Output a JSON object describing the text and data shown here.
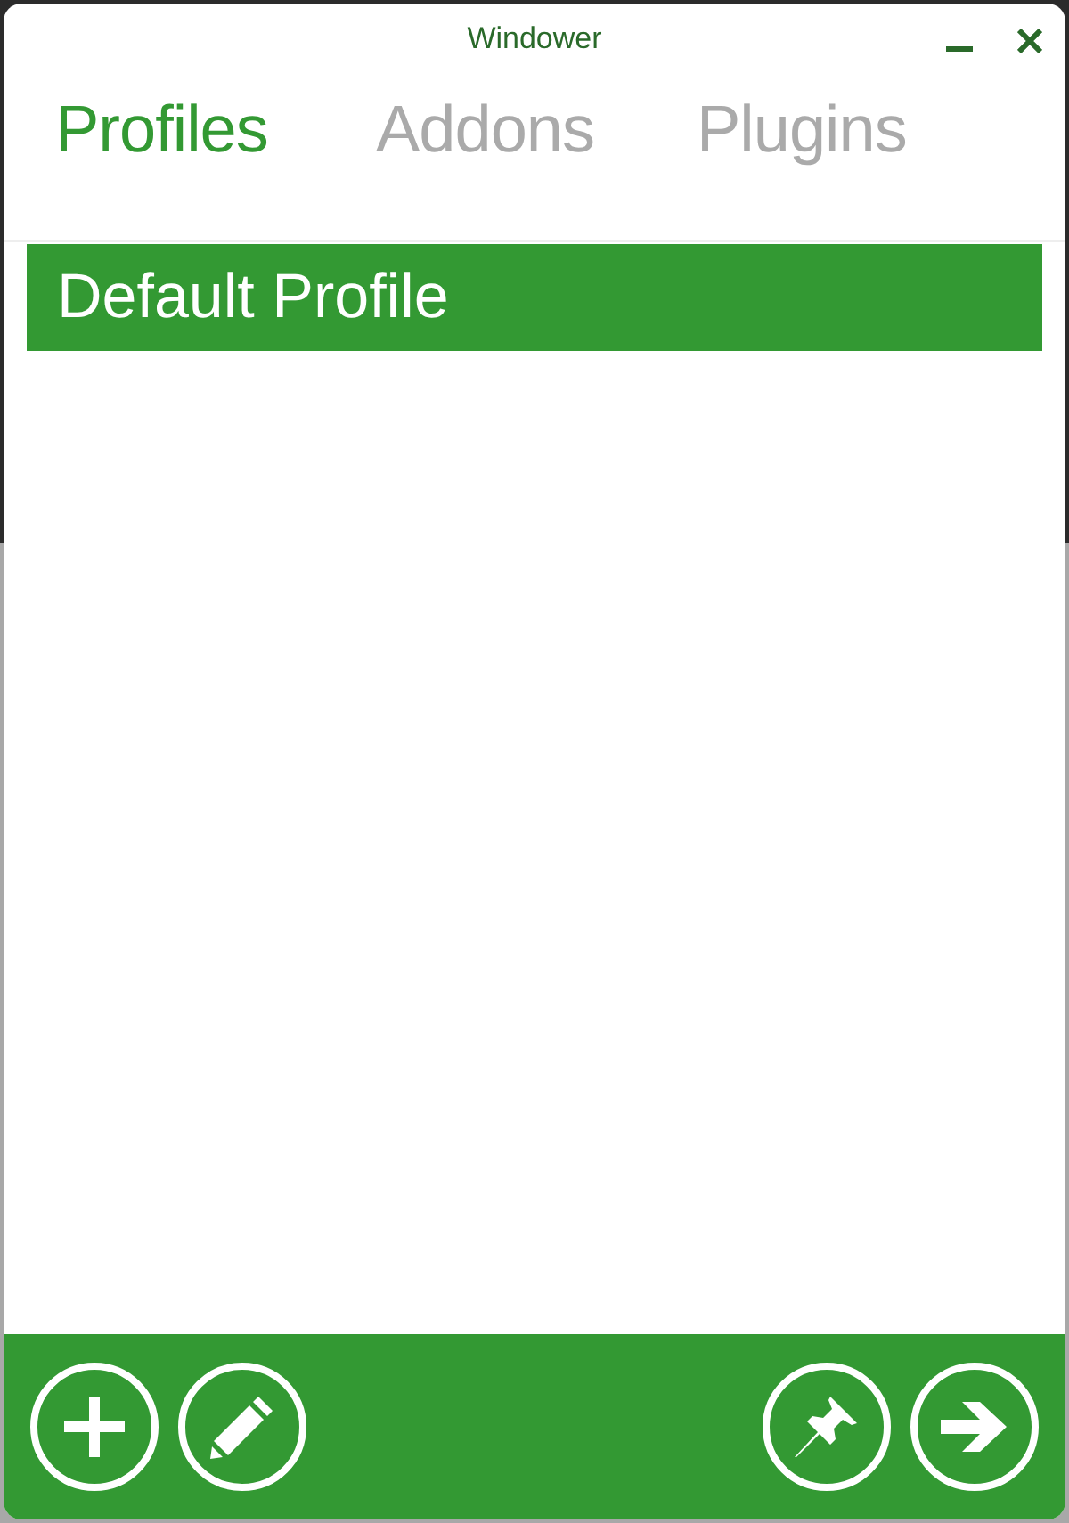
{
  "window": {
    "title": "Windower"
  },
  "tabs": [
    {
      "label": "Profiles",
      "selected": true
    },
    {
      "label": "Addons",
      "selected": false
    },
    {
      "label": "Plugins",
      "selected": false
    }
  ],
  "profiles": [
    {
      "name": "Default Profile",
      "selected": true
    }
  ],
  "toolbar": [
    {
      "kind": "add"
    },
    {
      "kind": "edit"
    },
    {
      "kind": "spacer"
    },
    {
      "kind": "pin"
    },
    {
      "kind": "launch"
    }
  ]
}
